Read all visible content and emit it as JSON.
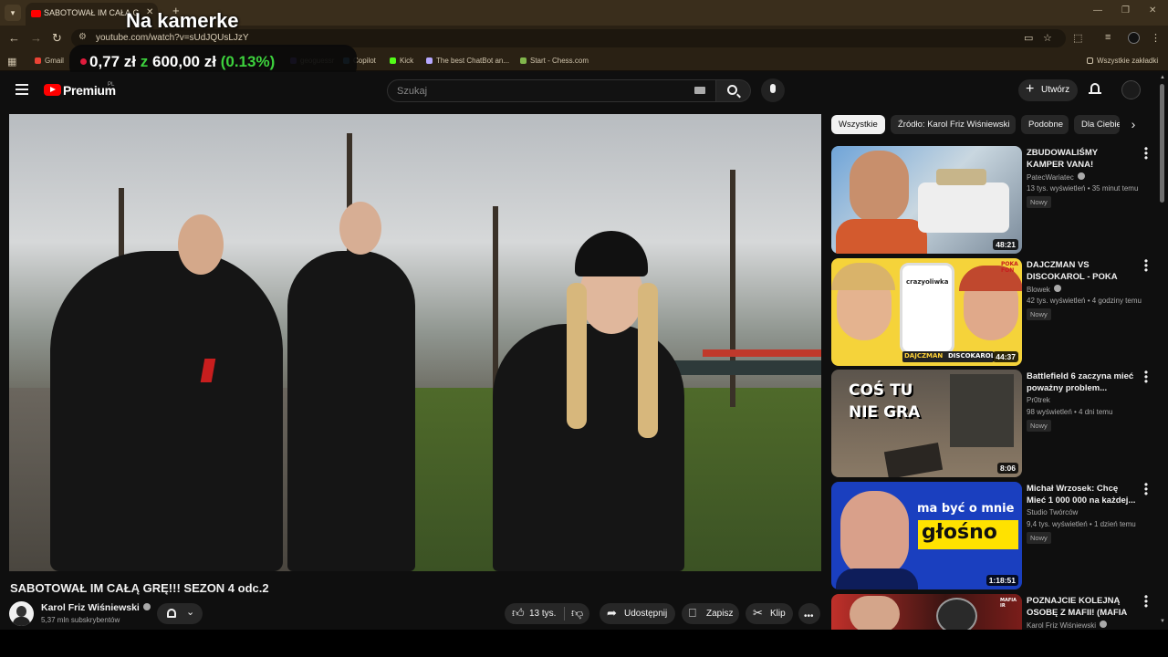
{
  "browser": {
    "tab_title": "SABOTOWAŁ IM CAŁĄ GRĘ",
    "new_tab": "+",
    "url": "youtube.com/watch?v=sUdJQUsLJzY",
    "bookmarks": [
      {
        "label": "Gmail",
        "color": "#ea4335"
      },
      {
        "label": "geoguessr",
        "color": "#7a5cff"
      },
      {
        "label": "Copilot",
        "color": "#4fb3ff"
      },
      {
        "label": "Kick",
        "color": "#53fc18"
      },
      {
        "label": "The best ChatBot an...",
        "color": "#b6a8ff"
      },
      {
        "label": "Start - Chess.com",
        "color": "#81b64c"
      }
    ],
    "all_bookmarks": "Wszystkie zakładki"
  },
  "overlay": {
    "title": "Na kamerke",
    "amount_current": "0,77 zł",
    "amount_sep": "z",
    "amount_goal": "600,00 zł",
    "amount_pct": "(0.13%)"
  },
  "header": {
    "brand": "Premium",
    "brand_sup": "PL",
    "search_placeholder": "Szukaj",
    "create_label": "Utwórz"
  },
  "video": {
    "title": "SABOTOWAŁ IM CAŁĄ GRĘ!!! SEZON 4 odc.2",
    "channel": "Karol Friz Wiśniewski",
    "subscribers": "5,37 mln subskrybentów",
    "likes": "13 tys.",
    "share": "Udostępnij",
    "save": "Zapisz",
    "clip": "Klip"
  },
  "chips": [
    "Wszystkie",
    "Źródło: Karol Friz Wiśniewski",
    "Podobne",
    "Dla Ciebie"
  ],
  "recommendations": [
    {
      "title": "ZBUDOWALIŚMY KAMPER VANA!",
      "channel": "PatecWariatec",
      "meta": "13 tys. wyświetleń • 35 minut temu",
      "badge": "Nowy",
      "duration": "48:21"
    },
    {
      "title": "DAJCZMAN VS DISCOKAROL - POKA FON...",
      "channel": "Blowek",
      "meta": "42 tys. wyświetleń • 4 godziny temu",
      "badge": "Nowy",
      "duration": "44:37"
    },
    {
      "title": "Battlefield 6 zaczyna mieć poważny problem...",
      "channel": "Pr0trek",
      "meta": "98 wyświetleń • 4 dni temu",
      "badge": "Nowy",
      "duration": "8:06"
    },
    {
      "title": "Michał Wrzosek: Chcę Mieć 1 000 000 na każdej...",
      "channel": "Studio Twórców",
      "meta": "9,4 tys. wyświetleń • 1 dzień temu",
      "badge": "Nowy",
      "duration": "1:18:51"
    },
    {
      "title": "POZNAJCIE KOLEJNĄ OSOBĘ Z MAFII! (MAFIA IR...",
      "channel": "Karol Friz Wiśniewski",
      "meta": "",
      "badge": "",
      "duration": ""
    }
  ],
  "thumb_text": {
    "r2_phone": "crazyoliwka",
    "r2_badge_a": "DAJCZMAN",
    "r2_badge_b": "DISCOKAROL",
    "r2_corner": "POKA FON",
    "r3_line1": "COŚ TU",
    "r3_line2": "NIE GRA",
    "r4_line1": "ma być o mnie",
    "r4_line2": "głośno",
    "r5_corner": "MAFIA IR"
  }
}
